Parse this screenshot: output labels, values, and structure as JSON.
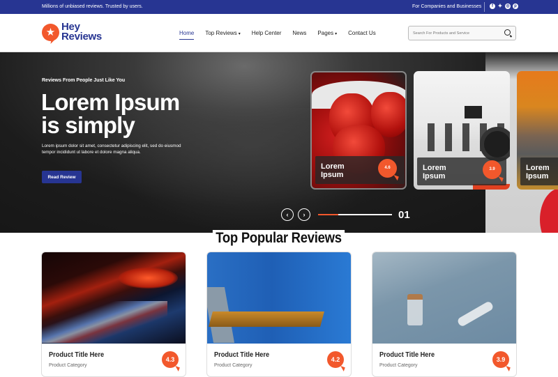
{
  "topbar": {
    "tagline": "Millions of unbiased reviews. Trusted by users.",
    "business_link": "For Companies and Businesses",
    "social": [
      {
        "icon": "facebook-icon",
        "glyph": "f"
      },
      {
        "icon": "twitter-icon",
        "glyph": "✦"
      },
      {
        "icon": "instagram-icon",
        "glyph": "◎"
      },
      {
        "icon": "pinterest-icon",
        "glyph": "p"
      }
    ]
  },
  "header": {
    "logo": {
      "line1": "Hey",
      "line2": "Reviews",
      "icon_glyph": "★"
    },
    "nav": [
      {
        "label": "Home",
        "active": true,
        "dropdown": false
      },
      {
        "label": "Top Reviews",
        "active": false,
        "dropdown": true
      },
      {
        "label": "Help Center",
        "active": false,
        "dropdown": false
      },
      {
        "label": "News",
        "active": false,
        "dropdown": false
      },
      {
        "label": "Pages",
        "active": false,
        "dropdown": true
      },
      {
        "label": "Contact Us",
        "active": false,
        "dropdown": false
      }
    ],
    "caret": "▾",
    "search": {
      "placeholder": "Search For Products and Service",
      "value": ""
    }
  },
  "hero": {
    "subtitle": "Reviews From People Just Like You",
    "title_line1": "Lorem Ipsum",
    "title_line2": "is simply",
    "body": "Lorem ipsum dolor sit amet, consectetur adipiscing elit, sed do eiusmod tempor incididunt ut labore et dolore magna aliqua.",
    "button": "Read Review",
    "cards": [
      {
        "title_line1": "Lorem",
        "title_line2": "Ipsum",
        "rating": "4.6"
      },
      {
        "title_line1": "Lorem",
        "title_line2": "Ipsum",
        "rating": "3.9"
      },
      {
        "title_line1": "Lorem",
        "title_line2": "Ipsum",
        "rating": ""
      }
    ],
    "slider": {
      "prev": "‹",
      "next": "›",
      "current": "01",
      "progress_fraction": 0.27
    }
  },
  "section": {
    "title": "Top Popular Reviews",
    "products": [
      {
        "title": "Product Title Here",
        "category": "Product Category",
        "rating": "4.3"
      },
      {
        "title": "Product Title Here",
        "category": "Product Category",
        "rating": "4.2"
      },
      {
        "title": "Product Title Here",
        "category": "Product Category",
        "rating": "3.9"
      }
    ]
  },
  "colors": {
    "brand_blue": "#273592",
    "accent_orange": "#f2582c"
  }
}
